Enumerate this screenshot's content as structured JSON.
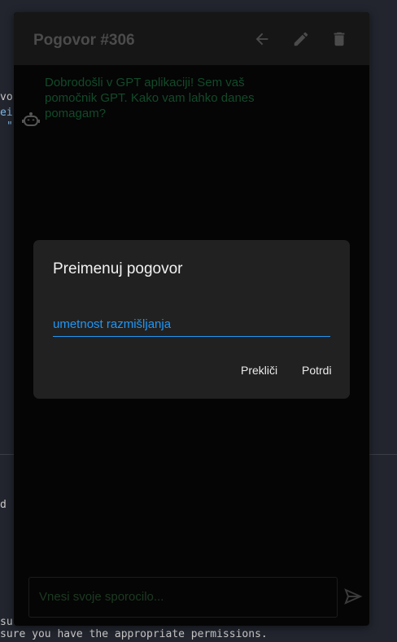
{
  "background_terminal": {
    "lines": [
      "vo",
      "ei",
      "\"",
      "d",
      "su",
      "sure you have the appropriate permissions."
    ]
  },
  "chat": {
    "title": "Pogovor #306",
    "icons": [
      "arrow-back-icon",
      "pencil-icon",
      "trash-icon"
    ],
    "messages": [
      {
        "sender": "bot",
        "text": "Dobrodošli v GPT aplikaciji! Sem vaš pomočnik GPT. Kako vam lahko danes pomagam?"
      }
    ],
    "input_placeholder": "Vnesi svoje sporocilo..."
  },
  "dialog": {
    "title": "Preimenuj pogovor",
    "field_value": "umetnost razmišljanja",
    "cancel_label": "Prekliči",
    "confirm_label": "Potrdi",
    "accent": "#2196f3"
  }
}
